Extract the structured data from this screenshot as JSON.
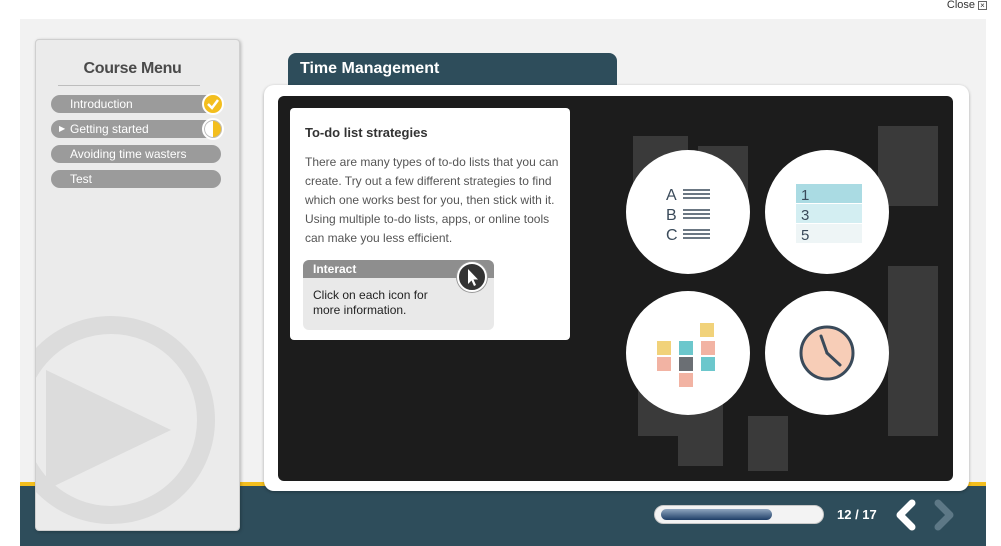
{
  "close_label": "Close",
  "sidebar": {
    "title": "Course Menu",
    "items": [
      {
        "label": "Introduction",
        "status": "complete"
      },
      {
        "label": "Getting started",
        "status": "in-progress",
        "current": true
      },
      {
        "label": "Avoiding time wasters",
        "status": "none"
      },
      {
        "label": "Test",
        "status": "none"
      }
    ]
  },
  "page_title": "Time Management",
  "card": {
    "title": "To-do list strategies",
    "body": "There are many types of to-do lists that you can create. Try out a few different strategies to find which one works best for you, then stick with it. Using multiple to-do lists, apps, or online tools can make you less efficient.",
    "interact_heading": "Interact",
    "interact_text": "Click on each icon for more information."
  },
  "icons": [
    {
      "name": "abc-list-icon",
      "letters": [
        "A",
        "B",
        "C"
      ]
    },
    {
      "name": "numbered-list-icon",
      "numbers": [
        "1",
        "3",
        "5"
      ]
    },
    {
      "name": "sticky-notes-icon"
    },
    {
      "name": "clock-icon"
    }
  ],
  "footer": {
    "progress": 0.71,
    "page_current": "12",
    "page_total": "17",
    "page_label": "12 / 17"
  },
  "colors": {
    "accent_yellow": "#f3be1e",
    "header_teal": "#2e4d5b",
    "menu_pill": "#9b9b9b"
  }
}
